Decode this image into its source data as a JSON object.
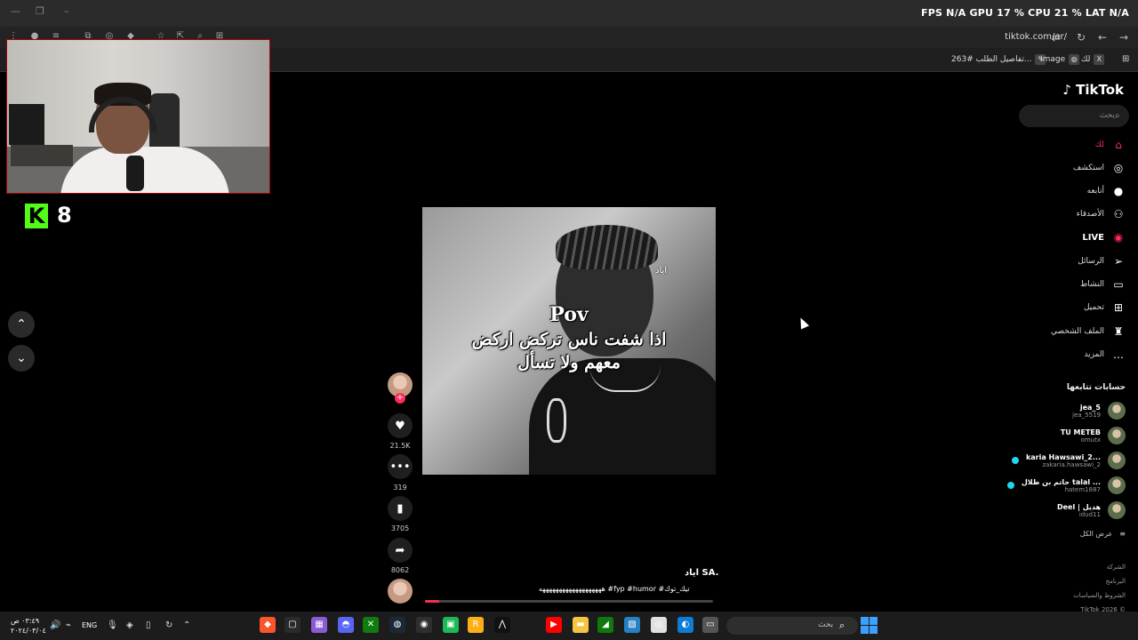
{
  "browser": {
    "url": "tiktok.com/ar/",
    "bookmarks": [
      {
        "label": "تفاصيل الطلب #263...",
        "icon": "pen-icon"
      },
      {
        "label": "Image",
        "icon": "globe-icon"
      },
      {
        "label": "لك",
        "icon": "x-icon"
      }
    ],
    "perf_overlay": "FPS N/A  GPU 17 %  CPU 21 %  LAT N/A"
  },
  "webcam": {
    "kick_count": "8"
  },
  "video": {
    "watermark": "اياد",
    "caption_line1": "Pov",
    "caption_line2": "اذا شفت ناس تركض اركض",
    "caption_line3": "معهم ولا تسأل",
    "author": "اياد SA.",
    "description": "هههههههههههههههههههه #fyp #humor #تيك_توك",
    "progress": 0.05,
    "likes": "21.5K",
    "comments": "319",
    "saves": "3705",
    "shares": "8062"
  },
  "sidebar": {
    "logo": "TikTok",
    "search_placeholder": "بحث",
    "nav": [
      {
        "label": "لك",
        "icon": "home-icon"
      },
      {
        "label": "استكشف",
        "icon": "compass-icon"
      },
      {
        "label": "أتابعه",
        "icon": "following-avatar-icon"
      },
      {
        "label": "الأصدقاء",
        "icon": "friends-icon"
      },
      {
        "label": "LIVE",
        "icon": "live-icon"
      },
      {
        "label": "الرسائل",
        "icon": "messages-icon"
      },
      {
        "label": "النشاط",
        "icon": "activity-icon"
      },
      {
        "label": "تحميل",
        "icon": "upload-icon"
      },
      {
        "label": "الملف الشخصي",
        "icon": "profile-icon"
      },
      {
        "label": "المزيد",
        "icon": "more-icon"
      }
    ],
    "following_title": "حسابات تتابعها",
    "following": [
      {
        "name": "jea_5",
        "handle": "jea_5519",
        "live": false
      },
      {
        "name": "TU METEB",
        "handle": "omutx",
        "live": false
      },
      {
        "name": "karia Hawsawi_2...",
        "handle": "zakaria.hawsawi_2",
        "live": true
      },
      {
        "name": "حاتم بن طلال talal ...",
        "handle": "hatem1887",
        "live": true
      },
      {
        "name": "Deel | هديل",
        "handle": "idud11",
        "live": false
      }
    ],
    "see_all": "عرض الكل",
    "footer": [
      "الشركة",
      "البرنامج",
      "الشروط والسياسات",
      "TikTok 2026 ©"
    ]
  },
  "taskbar": {
    "search": "بحث",
    "lang": "ENG",
    "time": "٠٣:٤٩ ص",
    "date": "٢٠٢٤/٠٣/٠٤"
  },
  "colors": {
    "accent": "#fe2c55",
    "kick": "#53fc18",
    "live": "#20d5ec"
  }
}
